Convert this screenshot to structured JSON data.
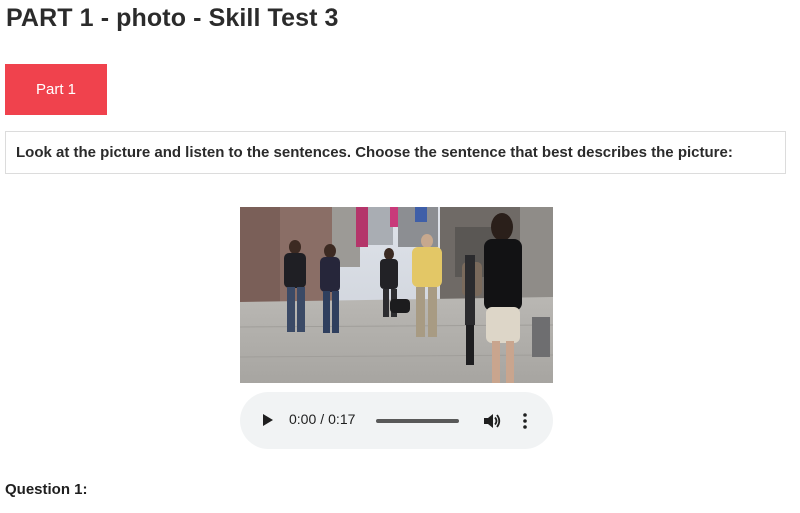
{
  "page": {
    "title": "PART 1 - photo - Skill Test 3"
  },
  "tabs": {
    "active_label": "Part 1"
  },
  "instruction": {
    "text": "Look at the picture and listen to the sentences. Choose the sentence that best describes the picture:"
  },
  "photo": {
    "subject": "city-sidewalk-pedestrians"
  },
  "audio": {
    "current_time": "0:00",
    "separator": "/",
    "duration": "0:17",
    "progress_fraction": 0.0,
    "icons": [
      "play-icon",
      "volume-icon",
      "more-options-icon"
    ]
  },
  "question": {
    "label": "Question 1:"
  },
  "colors": {
    "tab_bg": "#f0424d",
    "player_bg": "#f1f3f4",
    "text": "#2b2b2b"
  }
}
